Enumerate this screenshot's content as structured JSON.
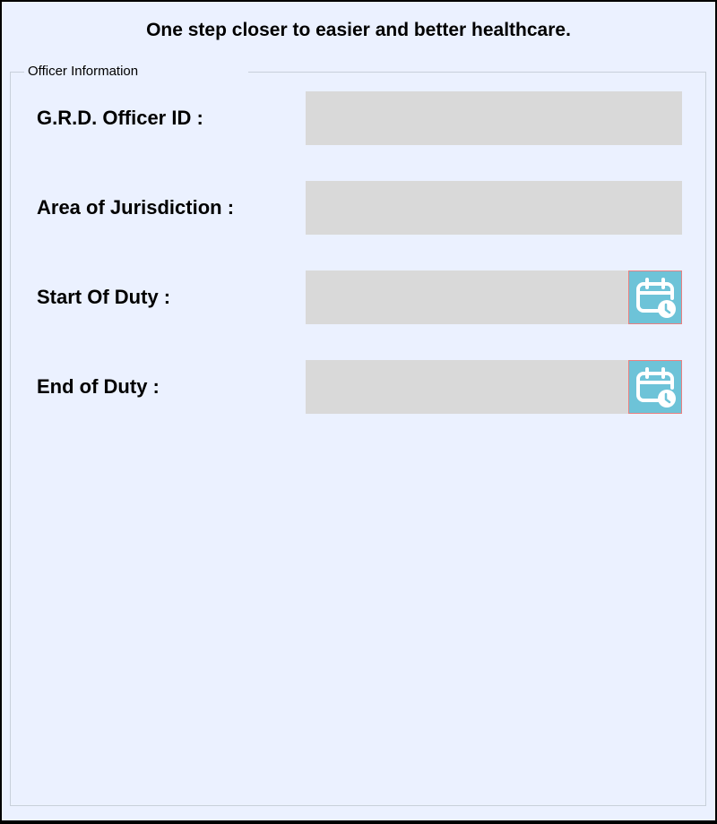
{
  "header": {
    "tagline": "One step closer to easier and better healthcare."
  },
  "form": {
    "group_title": "Officer Information",
    "fields": [
      {
        "label": "G.R.D. Officer ID :",
        "value": "",
        "has_calendar": false
      },
      {
        "label": "Area of Jurisdiction :",
        "value": "",
        "has_calendar": false
      },
      {
        "label": "Start Of Duty :",
        "value": "",
        "has_calendar": true,
        "icon": "calendar-clock-icon"
      },
      {
        "label": "End of Duty :",
        "value": "",
        "has_calendar": true,
        "icon": "calendar-clock-icon"
      }
    ]
  },
  "colors": {
    "background": "#ebf1ff",
    "input_background": "#d9d9d9",
    "calendar_button": "#6dc3d8",
    "calendar_button_border": "#e88080",
    "group_border": "#c8d0da"
  }
}
